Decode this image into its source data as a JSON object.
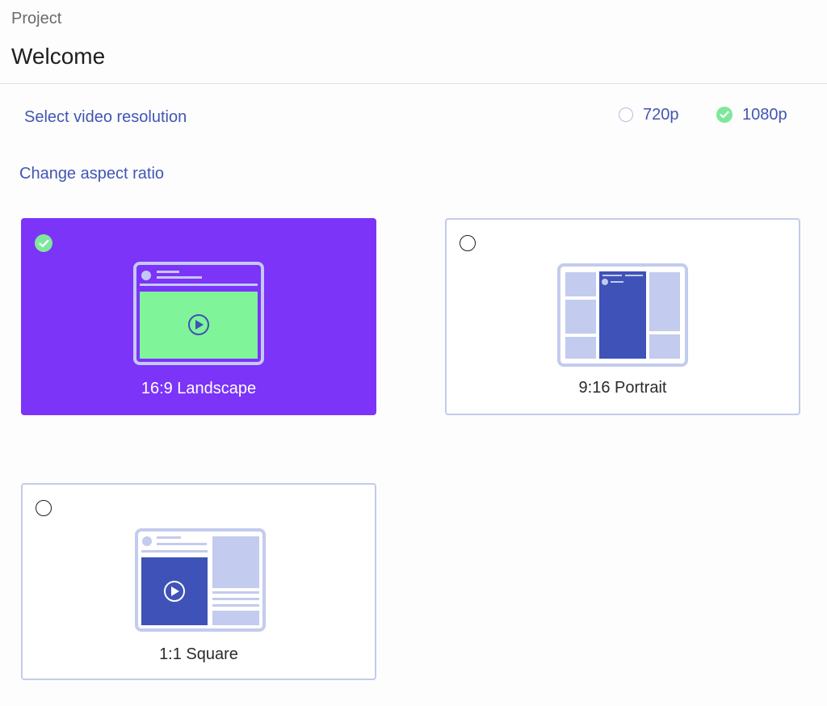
{
  "header": {
    "breadcrumb": "Project",
    "title": "Welcome"
  },
  "resolution": {
    "label": "Select video resolution",
    "options": [
      {
        "label": "720p",
        "selected": false
      },
      {
        "label": "1080p",
        "selected": true
      }
    ]
  },
  "aspect_ratio": {
    "label": "Change aspect ratio",
    "options": [
      {
        "label": "16:9 Landscape",
        "selected": true,
        "icon": "landscape-layout-icon"
      },
      {
        "label": "9:16 Portrait",
        "selected": false,
        "icon": "portrait-layout-icon"
      },
      {
        "label": "1:1 Square",
        "selected": false,
        "icon": "square-layout-icon"
      }
    ]
  },
  "colors": {
    "accent": "#7b34f8",
    "link": "#4156b5",
    "check_green": "#7ee89a",
    "card_border": "#c3cbea",
    "illustration_light": "#c3cbee",
    "illustration_dark": "#3e52b8"
  }
}
